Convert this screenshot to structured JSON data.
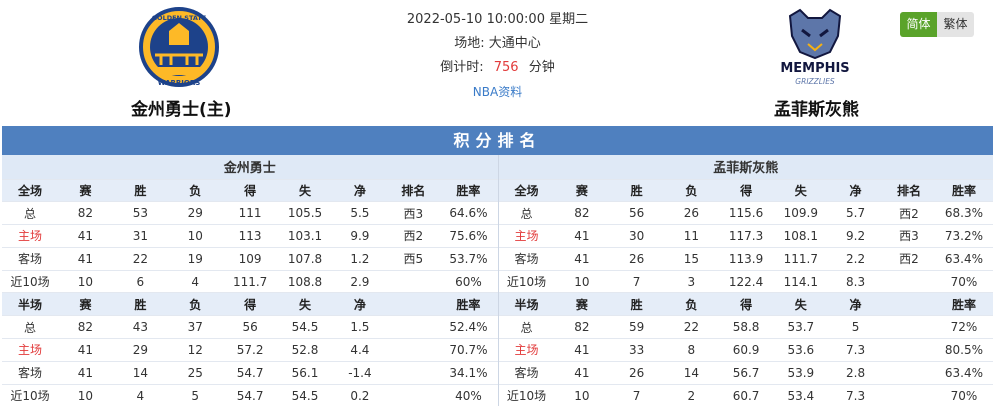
{
  "match": {
    "datetime": "2022-05-10 10:00:00 星期二",
    "venue": "场地: 大通中心",
    "countdown_label": "倒计时:",
    "countdown_value": "756",
    "countdown_unit": "分钟",
    "nba_link": "NBA资料"
  },
  "language": {
    "simplified": "简体",
    "traditional": "繁体"
  },
  "teams": {
    "home": {
      "name": "金州勇士(主)",
      "logo_text_top": "GOLDEN STATE",
      "logo_text_bottom": "WARRIORS"
    },
    "away": {
      "name": "孟菲斯灰熊",
      "logo_text_top": "MEMPHIS",
      "logo_text_bottom": "GRIZZLIES"
    }
  },
  "colors": {
    "header_blue": "#4f80bf",
    "accent_green": "#5aa32a",
    "home_red": "#e23b3b"
  },
  "standings": {
    "title": "积分排名",
    "sides": [
      {
        "team": "金州勇士",
        "full_headers": [
          "全场",
          "赛",
          "胜",
          "负",
          "得",
          "失",
          "净",
          "排名",
          "胜率"
        ],
        "full_rows": [
          [
            "总",
            "82",
            "53",
            "29",
            "111",
            "105.5",
            "5.5",
            "西3",
            "64.6%"
          ],
          [
            "主场",
            "41",
            "31",
            "10",
            "113",
            "103.1",
            "9.9",
            "西2",
            "75.6%"
          ],
          [
            "客场",
            "41",
            "22",
            "19",
            "109",
            "107.8",
            "1.2",
            "西5",
            "53.7%"
          ],
          [
            "近10场",
            "10",
            "6",
            "4",
            "111.7",
            "108.8",
            "2.9",
            "",
            "60%"
          ]
        ],
        "half_headers": [
          "半场",
          "赛",
          "胜",
          "负",
          "得",
          "失",
          "净",
          "",
          "胜率"
        ],
        "half_rows": [
          [
            "总",
            "82",
            "43",
            "37",
            "56",
            "54.5",
            "1.5",
            "",
            "52.4%"
          ],
          [
            "主场",
            "41",
            "29",
            "12",
            "57.2",
            "52.8",
            "4.4",
            "",
            "70.7%"
          ],
          [
            "客场",
            "41",
            "14",
            "25",
            "54.7",
            "56.1",
            "-1.4",
            "",
            "34.1%"
          ],
          [
            "近10场",
            "10",
            "4",
            "5",
            "54.7",
            "54.5",
            "0.2",
            "",
            "40%"
          ]
        ]
      },
      {
        "team": "孟菲斯灰熊",
        "full_headers": [
          "全场",
          "赛",
          "胜",
          "负",
          "得",
          "失",
          "净",
          "排名",
          "胜率"
        ],
        "full_rows": [
          [
            "总",
            "82",
            "56",
            "26",
            "115.6",
            "109.9",
            "5.7",
            "西2",
            "68.3%"
          ],
          [
            "主场",
            "41",
            "30",
            "11",
            "117.3",
            "108.1",
            "9.2",
            "西3",
            "73.2%"
          ],
          [
            "客场",
            "41",
            "26",
            "15",
            "113.9",
            "111.7",
            "2.2",
            "西2",
            "63.4%"
          ],
          [
            "近10场",
            "10",
            "7",
            "3",
            "122.4",
            "114.1",
            "8.3",
            "",
            "70%"
          ]
        ],
        "half_headers": [
          "半场",
          "赛",
          "胜",
          "负",
          "得",
          "失",
          "净",
          "",
          "胜率"
        ],
        "half_rows": [
          [
            "总",
            "82",
            "59",
            "22",
            "58.8",
            "53.7",
            "5",
            "",
            "72%"
          ],
          [
            "主场",
            "41",
            "33",
            "8",
            "60.9",
            "53.6",
            "7.3",
            "",
            "80.5%"
          ],
          [
            "客场",
            "41",
            "26",
            "14",
            "56.7",
            "53.9",
            "2.8",
            "",
            "63.4%"
          ],
          [
            "近10场",
            "10",
            "7",
            "2",
            "60.7",
            "53.4",
            "7.3",
            "",
            "70%"
          ]
        ]
      }
    ]
  }
}
